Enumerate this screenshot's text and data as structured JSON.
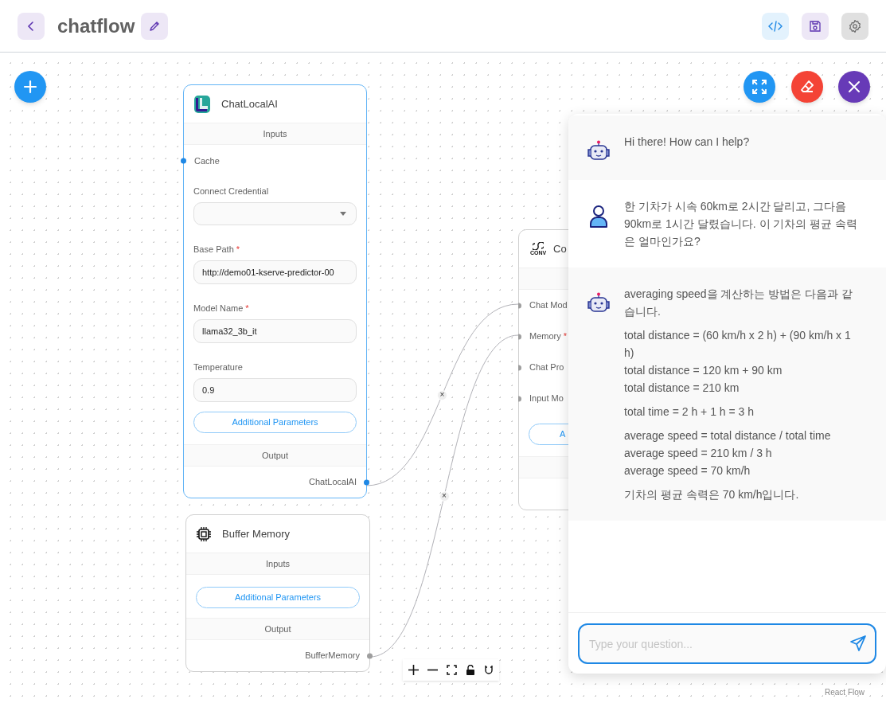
{
  "header": {
    "title": "chatflow"
  },
  "nodes": [
    {
      "title": "ChatLocalAI",
      "selected": true,
      "inputs_label": "Inputs",
      "inputs": [
        {
          "kind": "anchor",
          "label": "Cache"
        },
        {
          "kind": "select",
          "label": "Connect Credential"
        },
        {
          "kind": "text",
          "label": "Base Path",
          "required_mark": "*",
          "value": "http://demo01-kserve-predictor-00"
        },
        {
          "kind": "text",
          "label": "Model Name",
          "required_mark": "*",
          "value": "llama32_3b_it"
        },
        {
          "kind": "text",
          "label": "Temperature",
          "value": "0.9"
        },
        {
          "kind": "button",
          "label": "Additional Parameters"
        }
      ],
      "output_label": "Output",
      "output": "ChatLocalAI"
    },
    {
      "title": "Buffer Memory",
      "selected": false,
      "inputs_label": "Inputs",
      "inputs": [
        {
          "kind": "button",
          "label": "Additional Parameters"
        }
      ],
      "output_label": "Output",
      "output": "BufferMemory"
    },
    {
      "title": "Co",
      "selected": false,
      "icon_text": "CONV",
      "inputs": [
        {
          "kind": "anchor",
          "label": "Chat Mod"
        },
        {
          "kind": "anchor",
          "label": "Memory",
          "required_mark": "*"
        },
        {
          "kind": "anchor",
          "label": "Chat Pro"
        },
        {
          "kind": "anchor",
          "label": "Input Mo"
        },
        {
          "kind": "button",
          "label": "A"
        }
      ]
    }
  ],
  "edges": [
    {
      "delete": "×"
    },
    {
      "delete": "×"
    }
  ],
  "chat": {
    "messages": [
      {
        "kind": "bot",
        "paragraphs": [
          [
            "Hi there! How can I help?"
          ]
        ]
      },
      {
        "kind": "user",
        "paragraphs": [
          [
            "한 기차가 시속 60km로 2시간 달리고, 그다음 90km로 1시간 달렸습니다. 이 기차의 평균 속력은 얼마인가요?"
          ]
        ]
      },
      {
        "kind": "bot",
        "paragraphs": [
          [
            "averaging speed을 계산하는 방법은 다음과 같습니다."
          ],
          [
            "total distance = (60 km/h x 2 h) + (90 km/h x 1 h)",
            "total distance = 120 km + 90 km",
            "total distance = 210 km"
          ],
          [
            "total time = 2 h + 1 h = 3 h"
          ],
          [
            "average speed = total distance / total time",
            "average speed = 210 km / 3 h",
            "average speed = 70 km/h"
          ],
          [
            "기차의 평균 속력은 70 km/h입니다."
          ]
        ]
      }
    ],
    "input": {
      "placeholder": "Type your question..."
    }
  },
  "attribution": "React Flow"
}
